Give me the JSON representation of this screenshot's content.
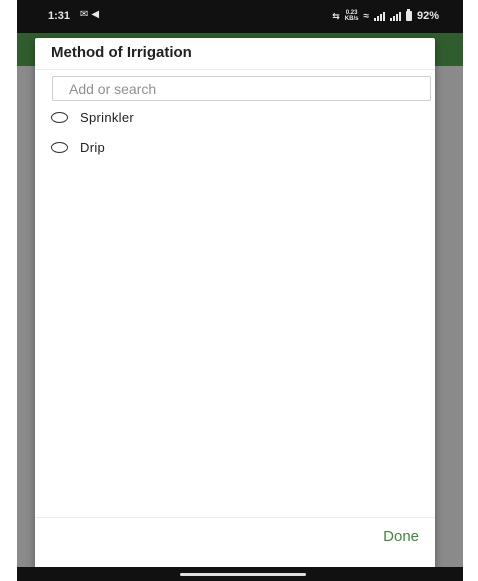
{
  "status_bar": {
    "time": "1:31",
    "left_icons": [
      "mail-icon",
      "send-icon"
    ],
    "data_speed": "0.23",
    "data_unit": "KB/s",
    "battery": "92%"
  },
  "dialog": {
    "title": "Method of Irrigation",
    "search": {
      "placeholder": "Add or search",
      "value": ""
    },
    "options": [
      {
        "label": "Sprinkler",
        "selected": false
      },
      {
        "label": "Drip",
        "selected": false
      }
    ],
    "done_label": "Done"
  },
  "colors": {
    "accent": "#3d8b37",
    "app_bar": "#2f5d2d",
    "scrim": "#8a8a8a"
  }
}
